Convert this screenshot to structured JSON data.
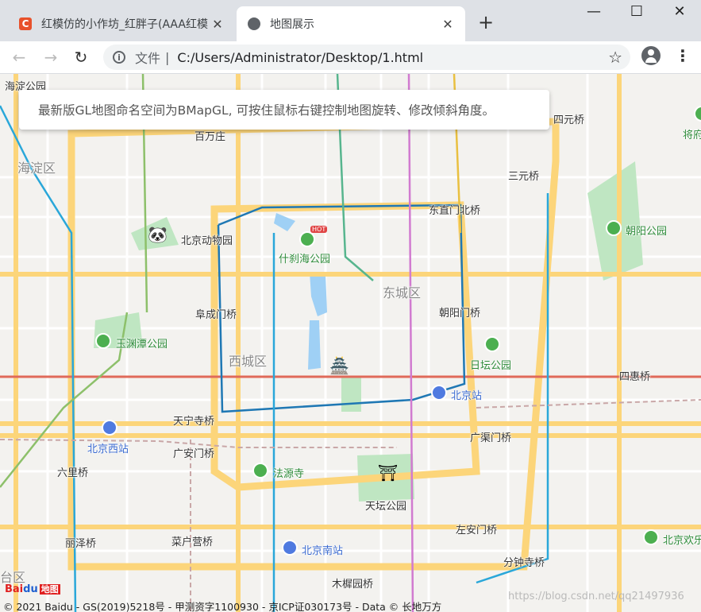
{
  "browser": {
    "tabs": [
      {
        "title": "红模仿的小作坊_红胖子(AAA红模",
        "icon": "csdn-icon",
        "close": "✕"
      },
      {
        "title": "地图展示",
        "icon": "globe-icon",
        "close": "✕"
      }
    ],
    "new_tab": "+",
    "window": {
      "minimize": "—",
      "maximize": "☐",
      "close": "✕"
    },
    "nav": {
      "back": "←",
      "forward": "→",
      "reload": "↻"
    },
    "address": {
      "scheme": "文件",
      "separator": "|",
      "url": "C:/Users/Administrator/Desktop/1.html"
    },
    "star": "☆",
    "menu": "⋮"
  },
  "notice": "最新版GL地图命名空间为BMapGL, 可按住鼠标右键控制地图旋转、修改倾斜角度。",
  "map": {
    "districts": [
      {
        "id": "haidian",
        "text": "海淀区"
      },
      {
        "id": "dongcheng",
        "text": "东城区"
      },
      {
        "id": "xicheng",
        "text": "西城区"
      },
      {
        "id": "fengtai",
        "text": "台区"
      }
    ],
    "labels": [
      {
        "id": "haidiangongyuan",
        "text": "海淀公园"
      },
      {
        "id": "baiwanzhuang",
        "text": "百万庄"
      },
      {
        "id": "sanyuanqiao",
        "text": "三元桥"
      },
      {
        "id": "siyuanqiao",
        "text": "四元桥"
      },
      {
        "id": "dongzhimenbeiqiao",
        "text": "东直门北桥"
      },
      {
        "id": "fuchengmenqiao",
        "text": "阜成门桥"
      },
      {
        "id": "chaoyangmenqiao",
        "text": "朝阳门桥"
      },
      {
        "id": "sihuiqiao",
        "text": "四惠桥"
      },
      {
        "id": "tianningsiqiao",
        "text": "天宁寺桥"
      },
      {
        "id": "guanganmenqiao",
        "text": "广安门桥"
      },
      {
        "id": "guangqumenqiao",
        "text": "广渠门桥"
      },
      {
        "id": "liuliqiao",
        "text": "六里桥"
      },
      {
        "id": "lizeqiao",
        "text": "丽泽桥"
      },
      {
        "id": "caihuyingqiao",
        "text": "菜户营桥"
      },
      {
        "id": "zuoanmenqiao",
        "text": "左安门桥"
      },
      {
        "id": "fenzhongsiqiao",
        "text": "分钟寺桥"
      },
      {
        "id": "muxiyuanqiao",
        "text": "木樨园桥"
      }
    ],
    "parks": [
      {
        "id": "zoo",
        "text": "北京动物园"
      },
      {
        "id": "shichahai",
        "text": "什刹海公园"
      },
      {
        "id": "chaoyanggongyuan",
        "text": "朝阳公园"
      },
      {
        "id": "yuyuantan",
        "text": "玉渊潭公园"
      },
      {
        "id": "ritan",
        "text": "日坛公园"
      },
      {
        "id": "fayuansi",
        "text": "法源寺"
      },
      {
        "id": "tiantan",
        "text": "天坛公园"
      },
      {
        "id": "jiang",
        "text": "将府"
      },
      {
        "id": "huanle",
        "text": "北京欢乐"
      }
    ],
    "stations": [
      {
        "id": "beijingzhan",
        "text": "北京站"
      },
      {
        "id": "beijingxizhan",
        "text": "北京西站"
      },
      {
        "id": "beijingnanzhan",
        "text": "北京南站"
      }
    ],
    "badge": "HOT"
  },
  "footer": {
    "logo_bai": "Bai",
    "logo_du": "du",
    "logo_map": "地图",
    "copyright": "© 2021 Baidu - GS(2019)5218号 - 甲测资字1100930 - 京ICP证030173号 - Data © 长地万方",
    "watermark": "https://blog.csdn.net/qq21497936"
  }
}
